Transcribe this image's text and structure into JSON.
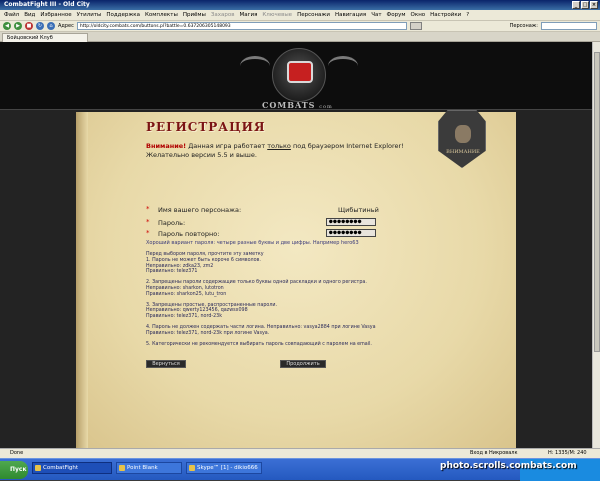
{
  "window": {
    "title": "CombatFight III - Old City"
  },
  "menu": [
    "Файл",
    "Вид",
    "Избранное",
    "Утилиты",
    "Поддержка",
    "Комплекты",
    "Приёмы",
    "Захаров",
    "Магия",
    "Ключевые",
    "Персонажи",
    "Навигация",
    "Чат",
    "Форум",
    "Окно",
    "Настройки",
    "?"
  ],
  "menu_dim": [
    7,
    9
  ],
  "toolbar": {
    "address_label": "Адрес",
    "address_value": "http://oldcity.combats.com/buttons.pl?battle=0.637206305148093",
    "person_label": "Персонаж:"
  },
  "tab": {
    "label": "Бойцовский Клуб"
  },
  "header": {
    "brand": "COMBATS",
    "brand_suffix": "com"
  },
  "badge": {
    "label": "ВНИМАНИЕ"
  },
  "page": {
    "title": "РЕГИСТРАЦИЯ",
    "warning_bold": "Внимание!",
    "warning_text_1": " Данная игра работает ",
    "warning_underlined": "только",
    "warning_text_2": " под браузером Internet Explorer! Желательно версии 5.5 и выше.",
    "bullet": "*",
    "name_label": "Имя вашего персонажа:",
    "name_value": "Щибытиньй",
    "password_label": "Пароль:",
    "password_value": "●●●●●●●●",
    "password2_label": "Пароль повторно:",
    "password2_value": "●●●●●●●●",
    "hint": "Хороший вариант пароля: четыре разные буквы и две цифры. Например hero63",
    "rules": [
      {
        "lines": [
          "Перед выбором пароля, прочтите эту заметку",
          "1. Пароль не может быть короче 6 символов.",
          "Неправильно: zdka23, zm2",
          "Правильно: telez371"
        ]
      },
      {
        "lines": [
          "2. Запрещены пароли содержащие только буквы одной раскладки и одного регистра.",
          "Неправильно: sharkon, lutotron",
          "Правильно: sharkon25, lutu_tron"
        ]
      },
      {
        "lines": [
          "3. Запрещены простые, распространенные пароли.",
          "Неправильно: qwerty123456, qazwsx098",
          "Правильно: telez371, nord-23k"
        ]
      },
      {
        "lines": [
          "4. Пароль не должен содержать части логина. Неправильно: vasya2884 при логине Vasya",
          "Правильно: telez371, nord-23k при логине Vasya."
        ]
      },
      {
        "lines": [
          "5. Категорически не рекомендуется выбирать пароль совпадающий с паролем на email."
        ]
      }
    ],
    "back_button": "Вернуться",
    "continue_button": "Продолжить"
  },
  "statusbar": {
    "left": "Done",
    "zone": "Вход в Никровалк",
    "right": "H: 1335/M: 240"
  },
  "taskbar": {
    "start": "Пуск",
    "items": [
      "CombatFight",
      "Point Blank",
      "Skype™ [1] - dikio666"
    ]
  },
  "watermark": "photo.scrolls.combats.com"
}
